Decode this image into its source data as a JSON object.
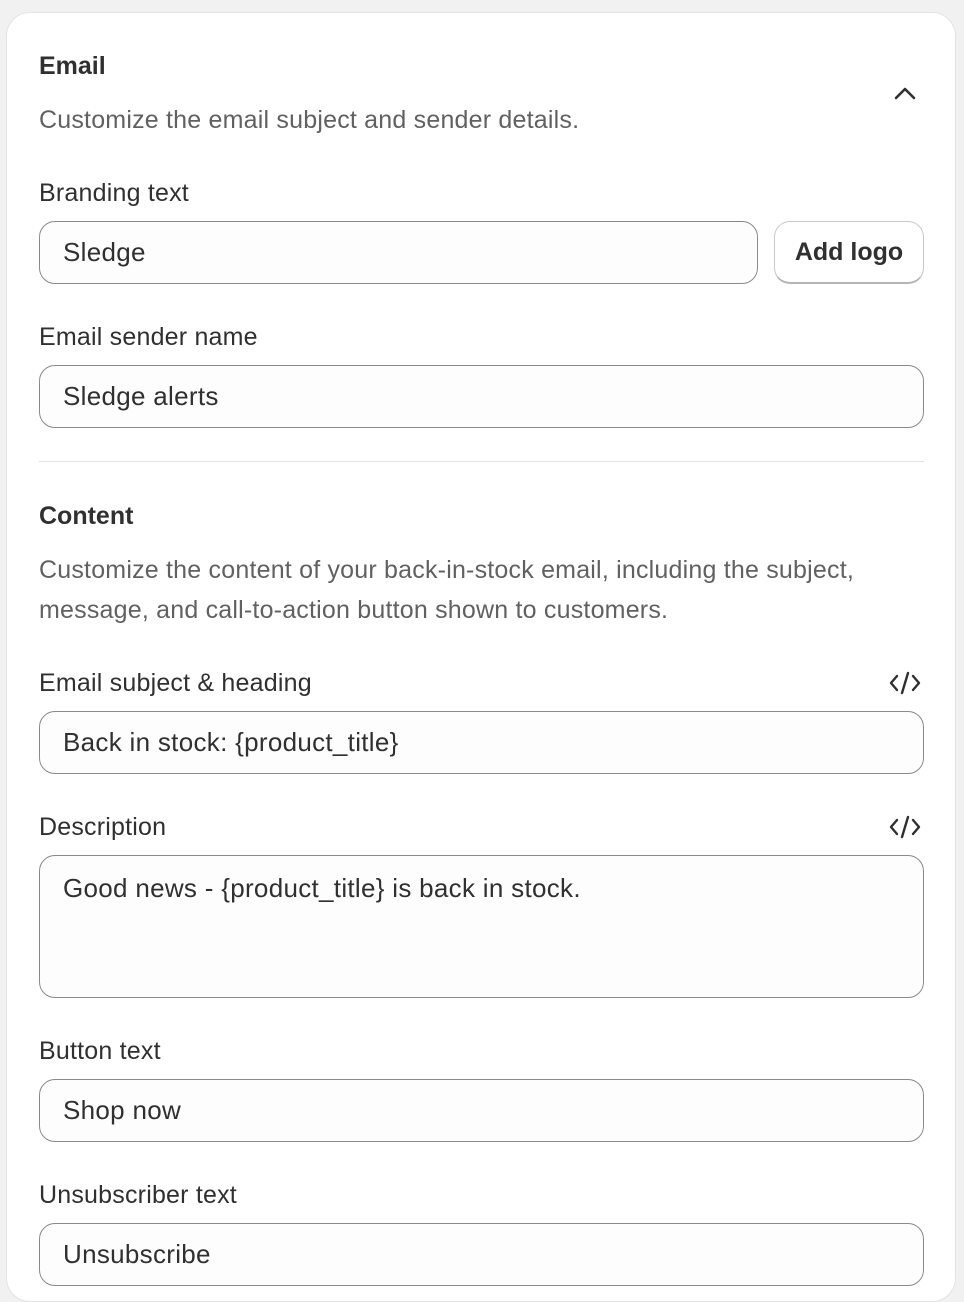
{
  "email_section": {
    "title": "Email",
    "description": "Customize the email subject and sender details.",
    "collapse_icon": "chevron-up-icon",
    "branding_label": "Branding text",
    "branding_value": "Sledge",
    "add_logo_label": "Add logo",
    "sender_label": "Email sender name",
    "sender_value": "Sledge alerts"
  },
  "content_section": {
    "title": "Content",
    "description": "Customize the content of your back-in-stock email, including the subject, message, and call-to-action button shown to customers.",
    "subject_label": "Email subject & heading",
    "subject_value": "Back in stock: {product_title}",
    "subject_icon": "code-icon",
    "description_label": "Description",
    "description_value": "Good news - {product_title} is back in stock.",
    "description_icon": "code-icon",
    "button_text_label": "Button text",
    "button_text_value": "Shop now",
    "unsubscribe_label": "Unsubscriber text",
    "unsubscribe_value": "Unsubscribe"
  }
}
